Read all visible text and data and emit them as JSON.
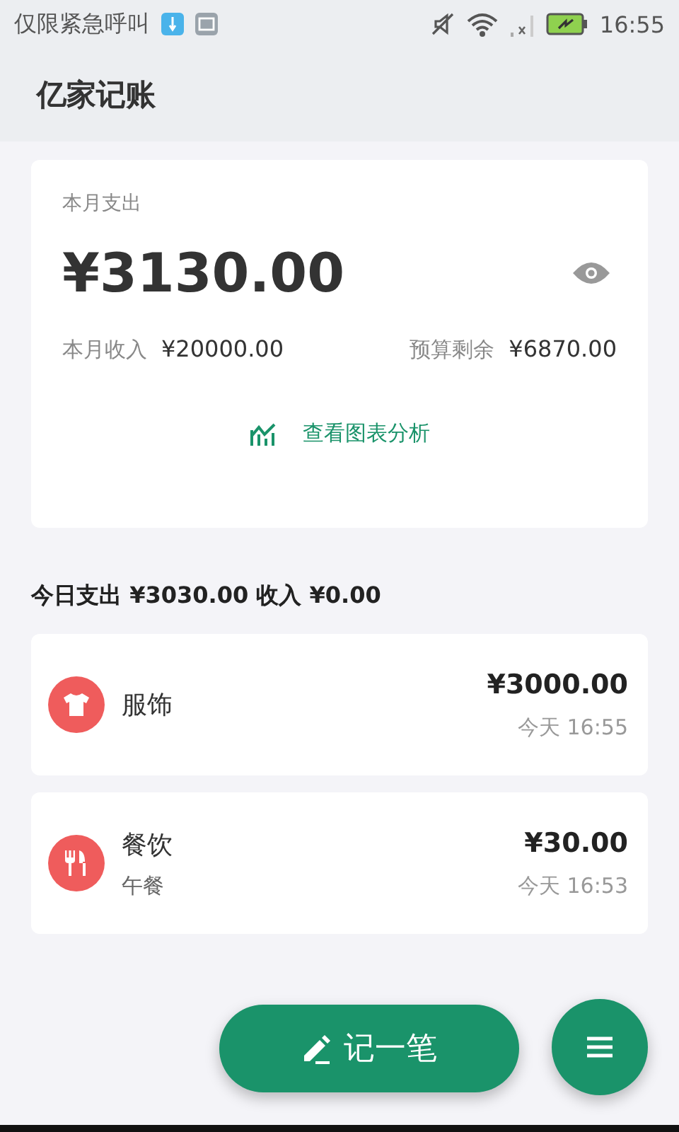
{
  "status_bar": {
    "carrier": "仅限紧急呼叫",
    "time": "16:55"
  },
  "app_bar": {
    "title": "亿家记账"
  },
  "summary": {
    "label": "本月支出",
    "amount": "¥3130.00",
    "income_label": "本月收入",
    "income": "¥20000.00",
    "budget_label": "预算剩余",
    "budget": "¥6870.00",
    "chart_link": "查看图表分析"
  },
  "today": {
    "text": "今日支出 ¥3030.00 收入 ¥0.00"
  },
  "transactions": [
    {
      "kind": "clothing",
      "category": "服饰",
      "amount": "¥3000.00",
      "time": "今天 16:55"
    },
    {
      "kind": "food",
      "category": "餐饮",
      "note": "午餐",
      "amount": "¥30.00",
      "time": "今天 16:53"
    }
  ],
  "add_button": {
    "label": "记一笔"
  }
}
